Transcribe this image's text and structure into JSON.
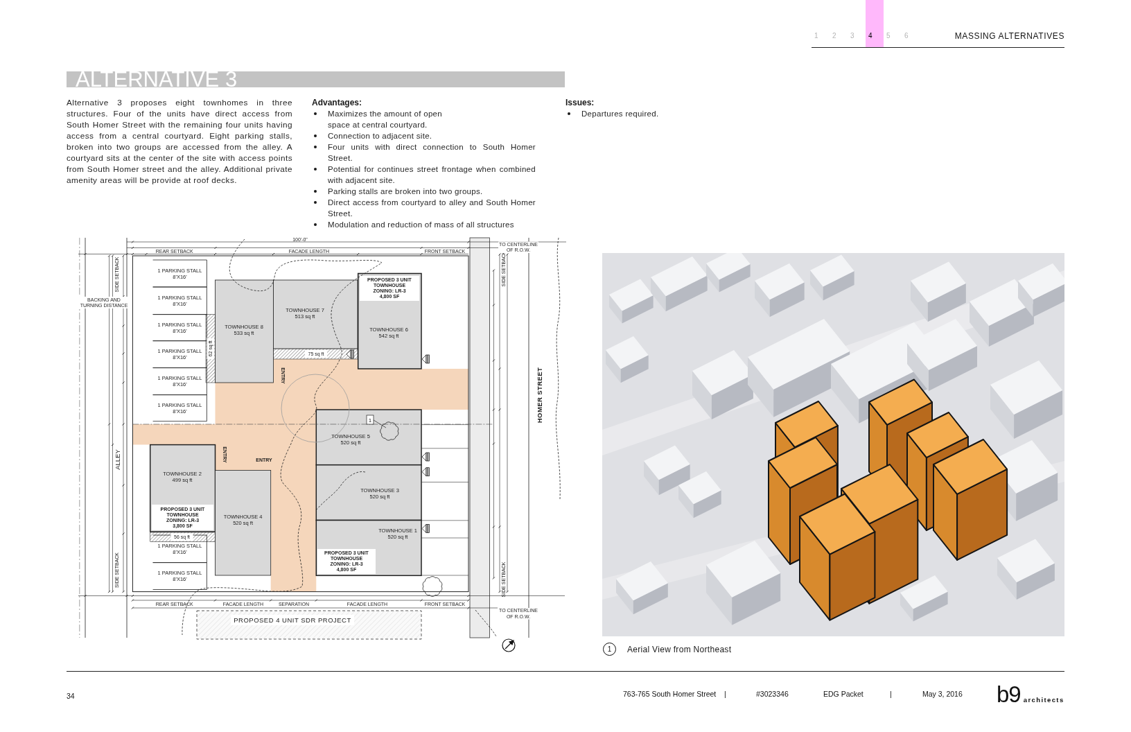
{
  "header": {
    "section_tabs": [
      {
        "label": "1",
        "selected": false
      },
      {
        "label": "2",
        "selected": false
      },
      {
        "label": "3",
        "selected": false
      },
      {
        "label": "4",
        "selected": true
      },
      {
        "label": "5",
        "selected": false
      },
      {
        "label": "6",
        "selected": false
      }
    ],
    "section_title": "MASSING ALTERNATIVES"
  },
  "title": "ALTERNATIVE 3",
  "intro": "Alternative 3 proposes eight townhomes in three structures. Four of the units have direct access from South Homer Street with the remaining four units having access from a central courtyard. Eight parking stalls, broken into two groups are accessed from the alley. A courtyard sits at the center of the site with access points from South Homer street and the alley. Additional private amenity areas will be provide at roof decks.",
  "advantages": {
    "heading": "Advantages:",
    "items": [
      "Maximizes the amount of open\nspace at central courtyard.",
      "Connection to adjacent site.",
      "Four units with direct connection to South Homer Street.",
      "Potential for continues street frontage when combined with adjacent site.",
      "Parking stalls are broken into two groups.",
      "Direct access from courtyard to alley and South Homer Street.",
      "Modulation and reduction of mass of all structures"
    ]
  },
  "issues": {
    "heading": "Issues:",
    "items": [
      "Departures required."
    ]
  },
  "site_plan": {
    "overall_dimension": "100'-0\"",
    "dimension_labels": [
      "REAR SETBACK",
      "FACADE LENGTH",
      "FRONT SETBACK",
      "REAR SETBACK",
      "FACADE LENGTH",
      "SEPARATION",
      "FACADE LENGTH",
      "FRONT SETBACK"
    ],
    "side_setbacks": [
      "SIDE SETBACK",
      "SIDE SETBACK",
      "SIDE SETBACK",
      "SIDE SETBACK"
    ],
    "row_notes": [
      {
        "lines": [
          "TO CENTERLINE",
          "OF R.O.W."
        ]
      },
      {
        "lines": [
          "TO CENTERLINE",
          "OF R.O.W."
        ]
      }
    ],
    "backing_note": {
      "lines": [
        "BACKING AND",
        "TURNING DISTANCE"
      ]
    },
    "alley_name": "ALLEY",
    "street_name": "HOMER STREET",
    "parking_stalls": [
      {
        "label": "1 PARKING STALL",
        "size": "8'X16'"
      },
      {
        "label": "1 PARKING STALL",
        "size": "8'X16'"
      },
      {
        "label": "1 PARKING STALL",
        "size": "8'X16'"
      },
      {
        "label": "1 PARKING STALL",
        "size": "8'X16'"
      },
      {
        "label": "1 PARKING STALL",
        "size": "8'X16'"
      },
      {
        "label": "1 PARKING STALL",
        "size": "8'X16'"
      },
      {
        "label": "1 PARKING STALL",
        "size": "8'X16'"
      },
      {
        "label": "1 PARKING STALL",
        "size": "8'X16'"
      }
    ],
    "townhouses": [
      {
        "name": "TOWNHOUSE 8",
        "area": "533 sq ft"
      },
      {
        "name": "TOWNHOUSE 7",
        "area": "513 sq ft"
      },
      {
        "name": "TOWNHOUSE 6",
        "area": "542 sq ft"
      },
      {
        "name": "TOWNHOUSE 5",
        "area": "520 sq ft"
      },
      {
        "name": "TOWNHOUSE 2",
        "area": "499 sq ft"
      },
      {
        "name": "TOWNHOUSE 3",
        "area": "520 sq ft"
      },
      {
        "name": "TOWNHOUSE 4",
        "area": "520 sq ft"
      },
      {
        "name": "TOWNHOUSE 1",
        "area": "520 sq ft"
      }
    ],
    "structure_notes": [
      {
        "title": "PROPOSED 3 UNIT TOWNHOUSE",
        "zoning": "ZONING: LR-3",
        "area": "4,800 SF"
      },
      {
        "title": "PROPOSED 3 UNIT TOWNHOUSE",
        "zoning": "ZONING: LR-3",
        "area": "3,800 SF"
      },
      {
        "title": "PROPOSED 3 UNIT TOWNHOUSE",
        "zoning": "ZONING: LR-3",
        "area": "4,800 SF"
      }
    ],
    "open_space_areas": [
      "62 sq ft",
      "75 sq ft",
      "56 sq ft"
    ],
    "entries": [
      "ENTRY",
      "ENTRY",
      "ENTRY"
    ],
    "tree_tag": "1",
    "neighbor_project": "PROPOSED 4 UNIT SDR PROJECT"
  },
  "aerial_view": {
    "caption_number": "1",
    "caption": "Aerial View from Northeast"
  },
  "footer": {
    "page_number": "34",
    "items": [
      "763-765 South Homer Street",
      "|",
      "#3023346",
      "EDG Packet",
      "|",
      "May 3, 2016"
    ],
    "logo": {
      "mark": "b9",
      "word": "architects"
    }
  }
}
